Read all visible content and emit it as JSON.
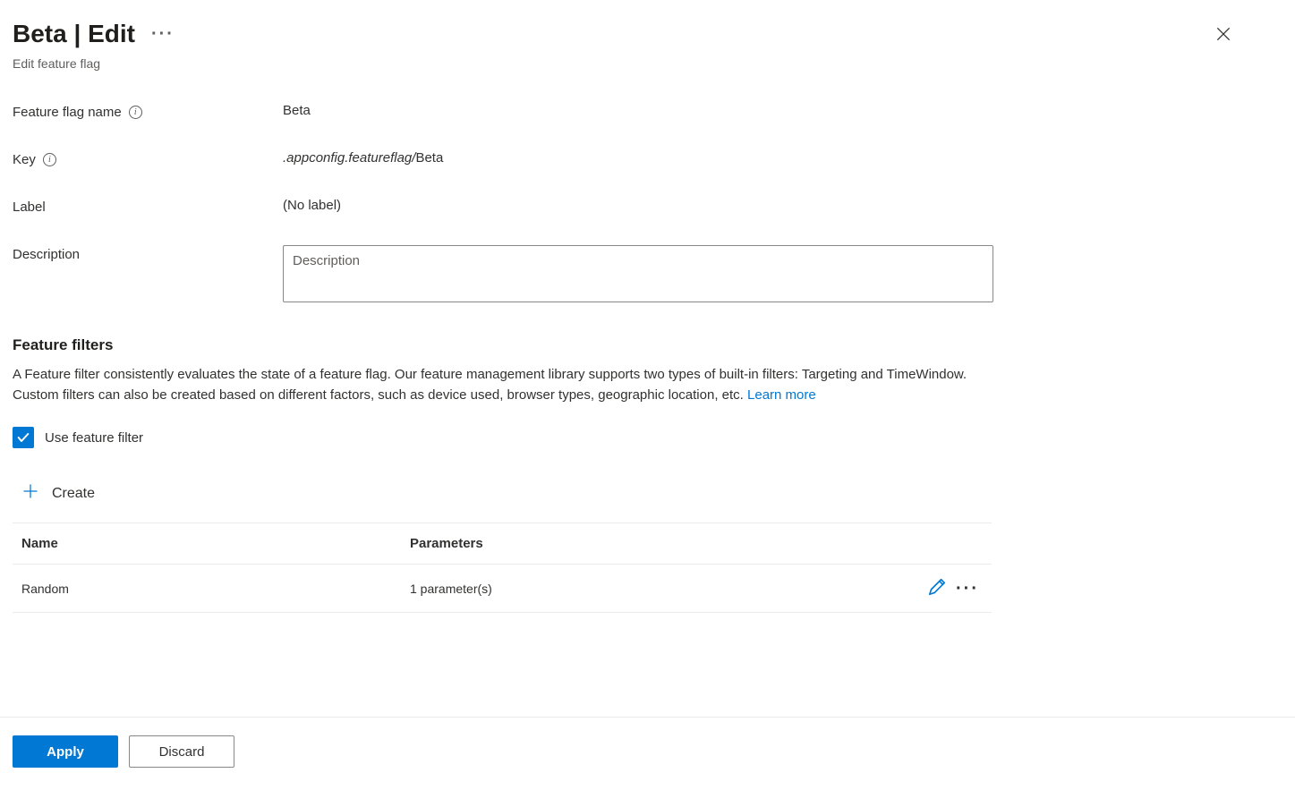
{
  "header": {
    "title": "Beta | Edit",
    "subtitle": "Edit feature flag"
  },
  "form": {
    "name_label": "Feature flag name",
    "name_value": "Beta",
    "key_label": "Key",
    "key_prefix": ".appconfig.featureflag/",
    "key_suffix": "Beta",
    "label_label": "Label",
    "label_value": "(No label)",
    "description_label": "Description",
    "description_placeholder": "Description"
  },
  "filters": {
    "heading": "Feature filters",
    "description": "A Feature filter consistently evaluates the state of a feature flag. Our feature management library supports two types of built-in filters: Targeting and TimeWindow. Custom filters can also be created based on different factors, such as device used, browser types, geographic location, etc. ",
    "learn_more": "Learn more",
    "checkbox_label": "Use feature filter",
    "create_label": "Create",
    "table": {
      "header_name": "Name",
      "header_params": "Parameters",
      "rows": [
        {
          "name": "Random",
          "params": "1 parameter(s)"
        }
      ]
    }
  },
  "footer": {
    "apply": "Apply",
    "discard": "Discard"
  }
}
